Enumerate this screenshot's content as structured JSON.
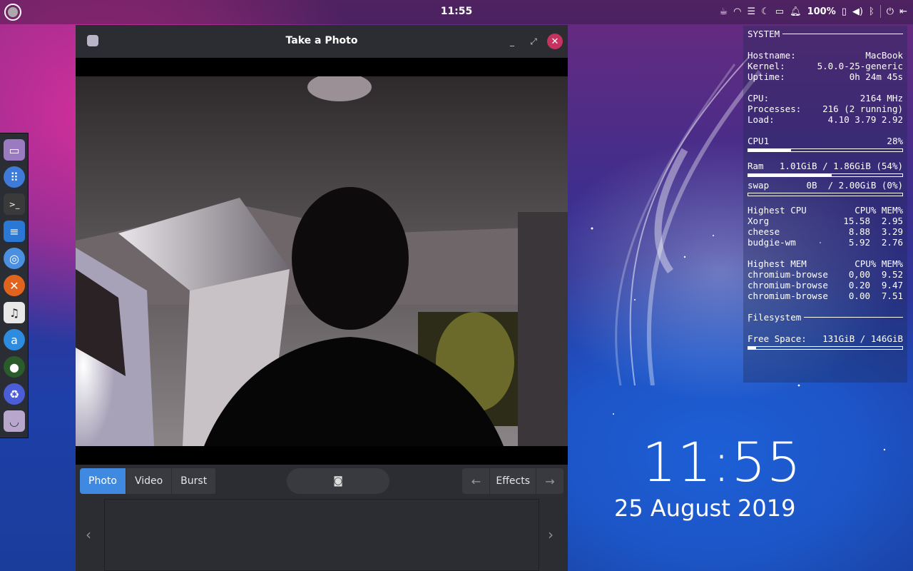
{
  "topbar": {
    "clock": "11:55",
    "battery": "100%"
  },
  "dock": {
    "items": [
      "files",
      "apps",
      "terminal",
      "text-editor",
      "chromium",
      "game",
      "music",
      "store",
      "obs",
      "recycle",
      "cheese"
    ]
  },
  "window": {
    "title": "Take a Photo",
    "modes": [
      "Photo",
      "Video",
      "Burst"
    ],
    "active_mode": "Photo",
    "effects_label": "Effects"
  },
  "conky": {
    "system_header": "SYSTEM",
    "hostname_label": "Hostname:",
    "hostname": "MacBook",
    "kernel_label": "Kernel:",
    "kernel": "5.0.0-25-generic",
    "uptime_label": "Uptime:",
    "uptime": "0h 24m 45s",
    "cpu_label": "CPU:",
    "cpu": "2164 MHz",
    "processes_label": "Processes:",
    "processes": "216 (2 running)",
    "load_label": "Load:",
    "load": "4.10 3.79 2.92",
    "cpu1_label": "CPU1",
    "cpu1": "28%",
    "cpu1_fraction": 0.28,
    "ram_label": "Ram",
    "ram": "1.01GiB / 1.86GiB (54%)",
    "ram_fraction": 0.54,
    "swap_label": "swap",
    "swap": "0B  / 2.00GiB (0%)",
    "swap_fraction": 0,
    "highest_cpu_header": "Highest CPU",
    "cpu_mem_header": "CPU% MEM%",
    "highest_cpu": [
      {
        "name": "Xorg",
        "cpu": "15.58",
        "mem": "2.95"
      },
      {
        "name": "cheese",
        "cpu": "8.88",
        "mem": "3.29"
      },
      {
        "name": "budgie-wm",
        "cpu": "5.92",
        "mem": "2.76"
      }
    ],
    "highest_mem_header": "Highest MEM",
    "highest_mem": [
      {
        "name": "chromium-browse",
        "cpu": "0.00",
        "mem": "9.52"
      },
      {
        "name": "chromium-browse",
        "cpu": "0.20",
        "mem": "9.47"
      },
      {
        "name": "chromium-browse",
        "cpu": "0.00",
        "mem": "7.51"
      }
    ],
    "filesystem_header": "Filesystem",
    "free_space_label": "Free Space:",
    "free_space": "131GiB / 146GiB",
    "fs_used_fraction": 0.05
  },
  "desktop": {
    "clock": "11:55",
    "date": "25 August 2019"
  },
  "colors": {
    "accent": "#3f8ae0",
    "close": "#c73261"
  }
}
